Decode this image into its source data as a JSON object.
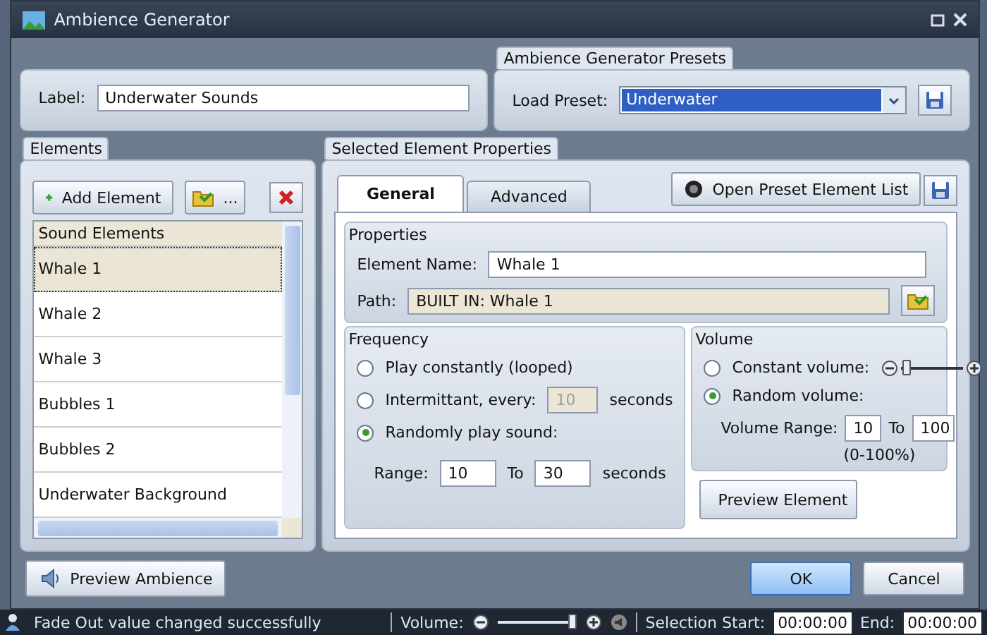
{
  "window": {
    "title": "Ambience Generator"
  },
  "label_field": {
    "label": "Label:",
    "value": "Underwater Sounds"
  },
  "presets": {
    "title": "Ambience Generator Presets",
    "label": "Load Preset:",
    "value": "Underwater"
  },
  "elements": {
    "title": "Elements",
    "add_button": "Add Element",
    "browse_button": "...",
    "list_header": "Sound Elements",
    "items": [
      {
        "name": "Whale 1",
        "selected": true
      },
      {
        "name": "Whale 2",
        "selected": false
      },
      {
        "name": "Whale 3",
        "selected": false
      },
      {
        "name": "Bubbles 1",
        "selected": false
      },
      {
        "name": "Bubbles 2",
        "selected": false
      },
      {
        "name": "Underwater Background",
        "selected": false
      }
    ]
  },
  "properties_panel": {
    "title": "Selected Element Properties",
    "tabs": [
      {
        "label": "General",
        "selected": true
      },
      {
        "label": "Advanced",
        "selected": false
      }
    ],
    "open_list_button": "Open Preset Element List",
    "properties": {
      "title": "Properties",
      "name_label": "Element Name:",
      "name_value": "Whale 1",
      "path_label": "Path:",
      "path_value": "BUILT IN: Whale 1"
    },
    "frequency": {
      "title": "Frequency",
      "options": [
        {
          "kind": "plain",
          "label": "Play constantly (looped)",
          "selected": false
        },
        {
          "kind": "interval",
          "label": "Intermittant, every:",
          "value": "10",
          "unit": "seconds",
          "disabled": true,
          "selected": false
        },
        {
          "kind": "plain",
          "label": "Randomly play sound:",
          "selected": true
        }
      ],
      "range_label": "Range:",
      "range_from": "10",
      "to_label": "To",
      "range_to": "30",
      "range_unit": "seconds"
    },
    "volume": {
      "title": "Volume",
      "options": [
        {
          "kind": "slider",
          "label": "Constant volume:",
          "level": 0.1,
          "selected": false
        },
        {
          "kind": "plain",
          "label": "Random volume:",
          "selected": true
        }
      ],
      "range_label": "Volume Range:",
      "range_from": "10",
      "to_label": "To",
      "range_to": "100",
      "hint": "(0-100%)"
    },
    "preview_button": "Preview Element"
  },
  "preview_ambience_button": "Preview Ambience",
  "ok_button": "OK",
  "cancel_button": "Cancel",
  "status_bar": {
    "message": "Fade Out value changed successfully",
    "volume_label": "Volume:",
    "volume": {
      "level": 0.95
    },
    "selection_start_label": "Selection Start:",
    "selection_start": "00:00:00",
    "end_label": "End:",
    "end": "00:00:00"
  }
}
